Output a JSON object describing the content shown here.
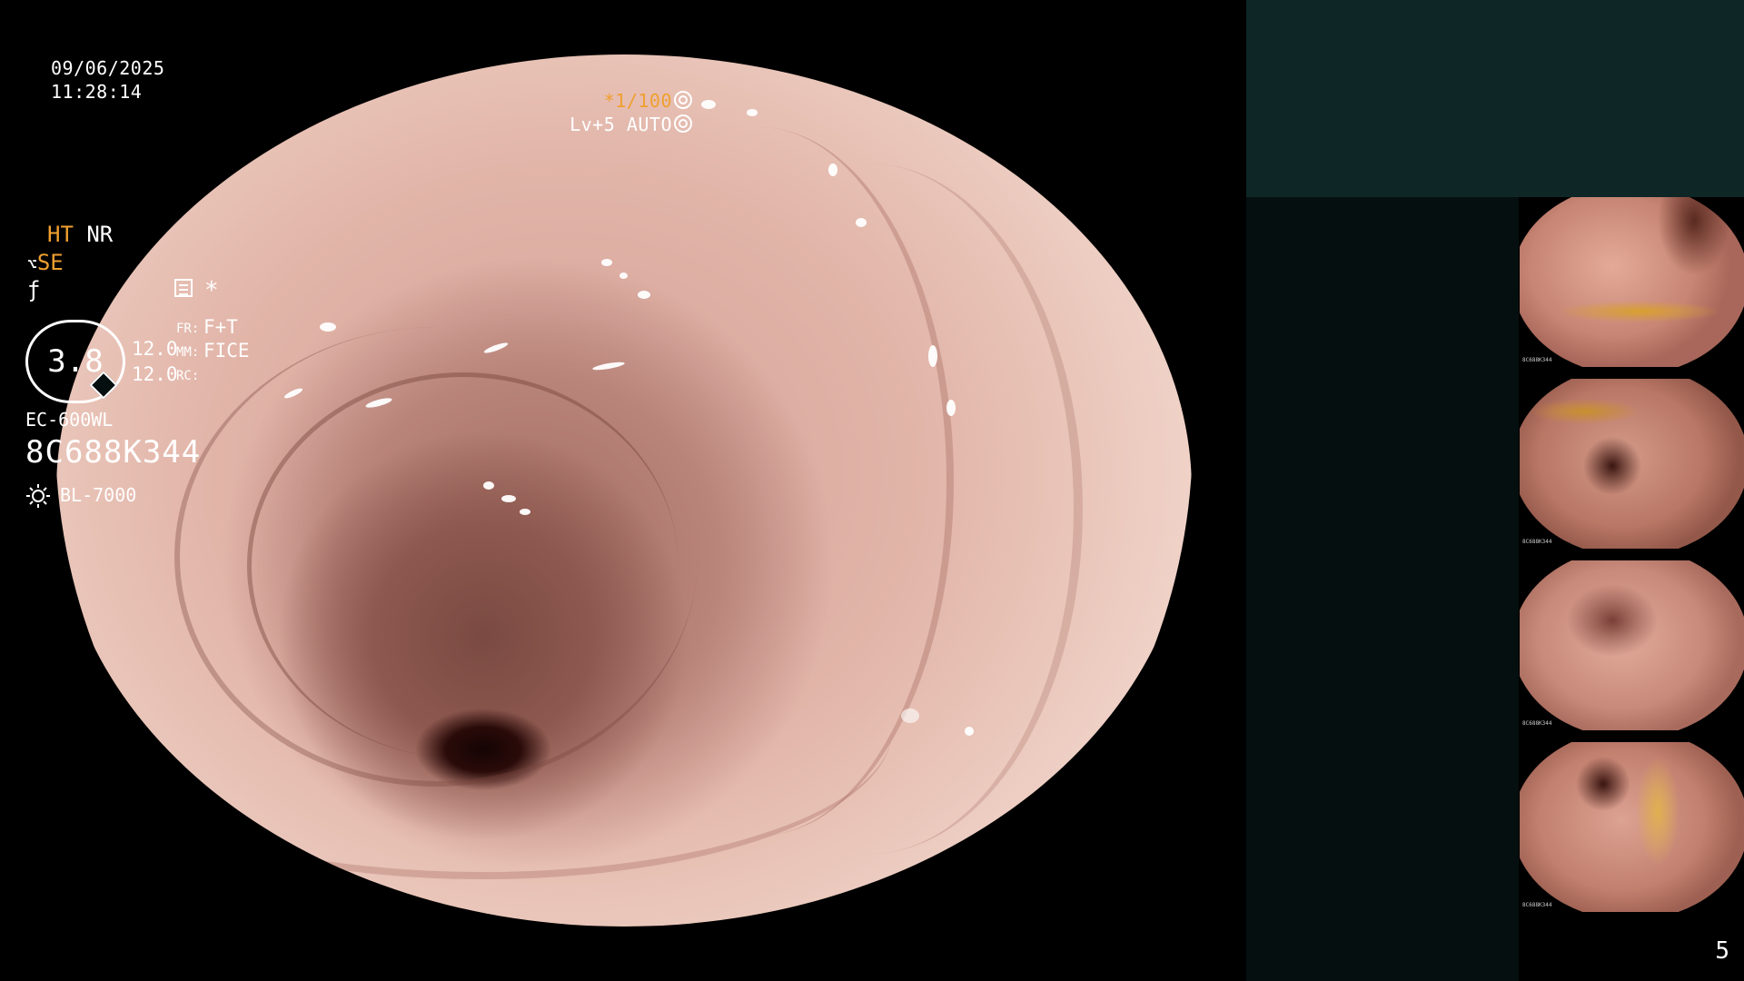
{
  "overlay": {
    "date": "09/06/2025",
    "time": "11:28:14",
    "shutter_speed": "*1/100",
    "level_label": "Lv+5 AUTO"
  },
  "panel": {
    "mode_ht": "HT",
    "mode_nr": "NR",
    "mode_se": "SE",
    "zoom_value": "3.8",
    "value_top": "12.0",
    "value_bottom": "12.0",
    "fr_label": "FR:",
    "fr_value": "F+T",
    "mm_label": "MM:",
    "mm_value": "FICE",
    "rc_label": "RC:",
    "scope_model": "EC-600WL",
    "scope_serial": "8C688K344",
    "light_source": "BL-7000",
    "star": "*"
  },
  "thumbnails": [
    {
      "caption": "8C688K344",
      "tone": "yellow-bile"
    },
    {
      "caption": "8C688K344",
      "tone": "lumen-yellow"
    },
    {
      "caption": "8C688K344",
      "tone": "folds"
    },
    {
      "caption": "8C688K344",
      "tone": "polyp-yellow"
    }
  ],
  "page_number": "5",
  "colors": {
    "accent": "#f0a030",
    "panel_top": "#0e2626",
    "panel_info": "#050f0f"
  },
  "icons": [
    "shutter-icon",
    "auto-icon",
    "scope-mode-icon",
    "function-icon",
    "menu-icon",
    "zoom-octagon-icon",
    "light-source-icon"
  ]
}
